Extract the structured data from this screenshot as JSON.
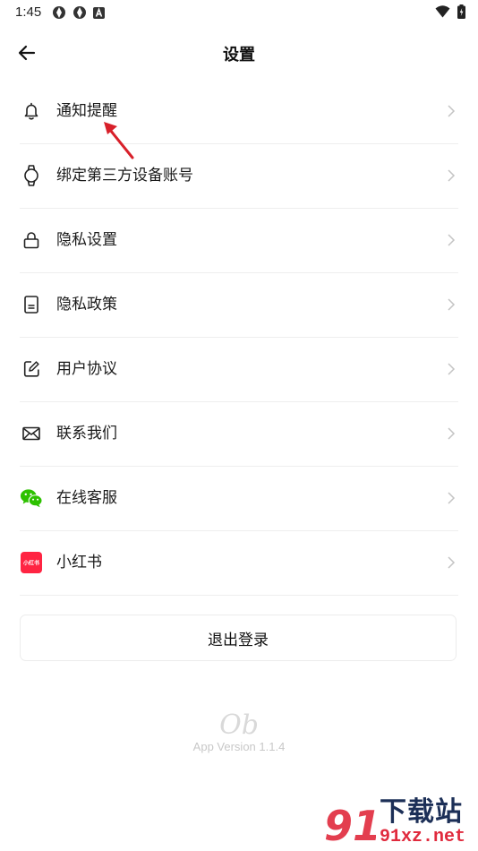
{
  "status_bar": {
    "time": "1:45"
  },
  "header": {
    "title": "设置"
  },
  "menu": {
    "items": [
      {
        "label": "通知提醒",
        "icon": "bell-icon"
      },
      {
        "label": "绑定第三方设备账号",
        "icon": "smartwatch-icon"
      },
      {
        "label": "隐私设置",
        "icon": "lock-icon"
      },
      {
        "label": "隐私政策",
        "icon": "document-icon"
      },
      {
        "label": "用户协议",
        "icon": "edit-icon"
      },
      {
        "label": "联系我们",
        "icon": "mail-icon"
      },
      {
        "label": "在线客服",
        "icon": "wechat-icon"
      },
      {
        "label": "小红书",
        "icon": "xiaohongshu-icon"
      }
    ]
  },
  "logout": {
    "label": "退出登录"
  },
  "footer": {
    "logo_text": "Ob",
    "version": "App Version 1.1.4"
  },
  "xiaohongshu_badge_text": "小红书",
  "watermark": {
    "brand": "下载站",
    "url": "91xz.net",
    "logo_mark": "91"
  },
  "colors": {
    "wechat": "#2dc100",
    "xiaohongshu": "#ff2442",
    "annotation_arrow": "#d8202a",
    "watermark_red": "#e02a3d",
    "watermark_navy": "#1c2f57"
  }
}
